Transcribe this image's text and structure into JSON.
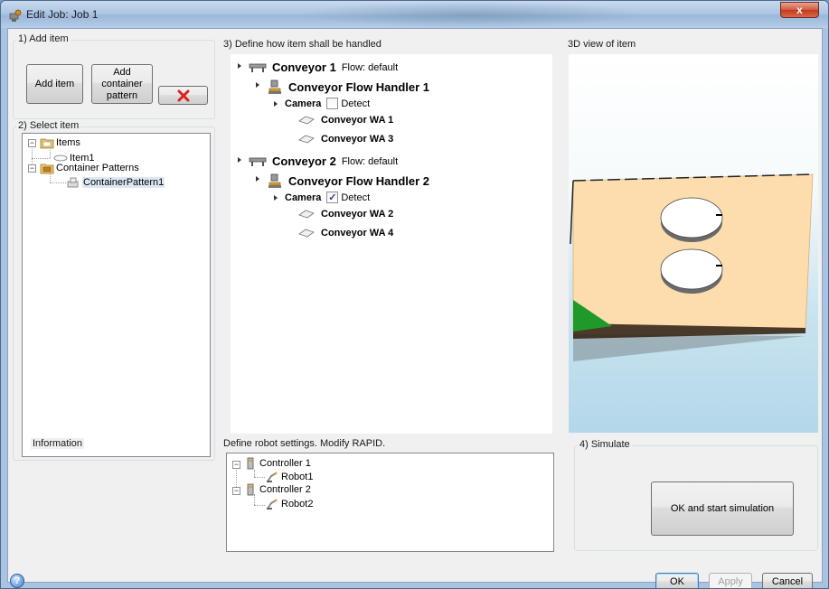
{
  "window": {
    "title": "Edit Job: Job 1",
    "close_glyph": "x"
  },
  "add_item": {
    "group_label": "1) Add item",
    "add_item_label": "Add item",
    "add_container_label": "Add container pattern",
    "delete_icon": "red-x-icon"
  },
  "select_item": {
    "group_label": "2) Select item",
    "tree": [
      {
        "label": "Items",
        "icon": "folder-icon"
      },
      {
        "label": "Item1",
        "icon": "item-icon"
      },
      {
        "label": "Container Patterns",
        "icon": "folder-icon"
      },
      {
        "label": "ContainerPattern1",
        "icon": "container-pattern-icon",
        "selected": true
      }
    ]
  },
  "information": {
    "group_label": "Information"
  },
  "define": {
    "group_label": "3) Define how item shall be handled",
    "conveyors": [
      {
        "name": "Conveyor 1",
        "flow": "Flow: default",
        "handler": "Conveyor Flow Handler 1",
        "camera": "Camera",
        "detect_label": "Detect",
        "detect_checked": false,
        "work_areas": [
          "Conveyor WA 1",
          "Conveyor WA 3"
        ]
      },
      {
        "name": "Conveyor 2",
        "flow": "Flow: default",
        "handler": "Conveyor Flow Handler 2",
        "camera": "Camera",
        "detect_label": "Detect",
        "detect_checked": true,
        "work_areas": [
          "Conveyor WA 2",
          "Conveyor WA 4"
        ]
      }
    ]
  },
  "robot_settings": {
    "group_label": "Define robot settings. Modify RAPID.",
    "tree": [
      {
        "label": "Controller 1",
        "icon": "controller-icon"
      },
      {
        "label": "Robot1",
        "icon": "robot-icon"
      },
      {
        "label": "Controller 2",
        "icon": "controller-icon"
      },
      {
        "label": "Robot2",
        "icon": "robot-icon"
      }
    ]
  },
  "view3d": {
    "group_label": "3D view of item",
    "colors": {
      "table": "#fddcae",
      "sky": "#b3d8ea",
      "marker": "#1f9a2a"
    }
  },
  "simulate": {
    "group_label": "4) Simulate",
    "button_label": "OK and start simulation"
  },
  "footer": {
    "ok_label": "OK",
    "apply_label": "Apply",
    "cancel_label": "Cancel",
    "help_glyph": "?"
  }
}
